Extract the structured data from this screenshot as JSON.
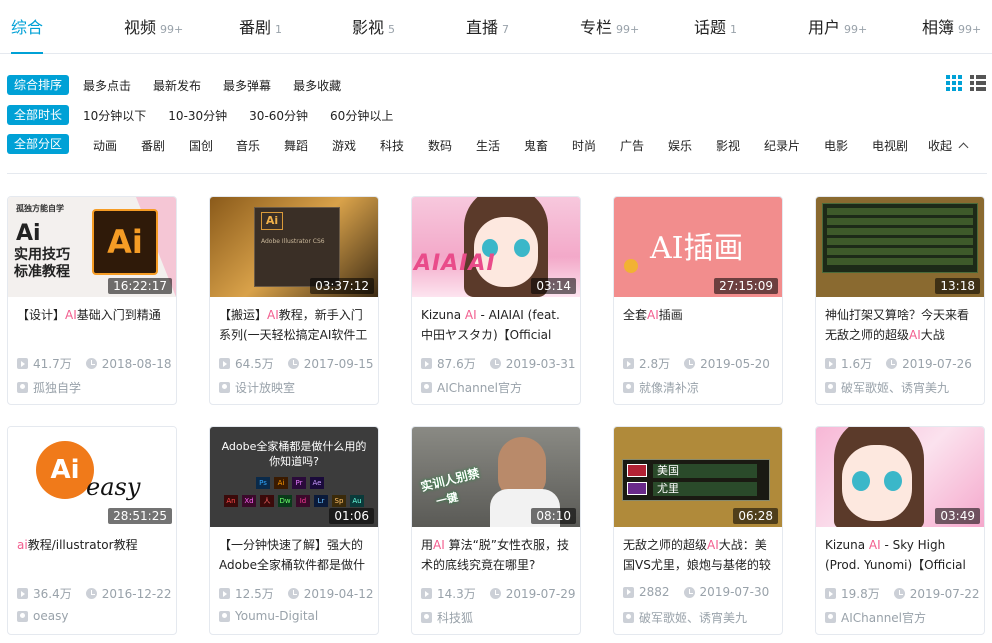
{
  "tabs": [
    {
      "label": "综合",
      "count": ""
    },
    {
      "label": "视频",
      "count": "99+"
    },
    {
      "label": "番剧",
      "count": "1"
    },
    {
      "label": "影视",
      "count": "5"
    },
    {
      "label": "直播",
      "count": "7"
    },
    {
      "label": "专栏",
      "count": "99+"
    },
    {
      "label": "话题",
      "count": "1"
    },
    {
      "label": "用户",
      "count": "99+"
    },
    {
      "label": "相簿",
      "count": "99+"
    }
  ],
  "filters": {
    "order": {
      "tag": "综合排序",
      "options": [
        "最多点击",
        "最新发布",
        "最多弹幕",
        "最多收藏"
      ]
    },
    "duration": {
      "tag": "全部时长",
      "options": [
        "10分钟以下",
        "10-30分钟",
        "30-60分钟",
        "60分钟以上"
      ]
    },
    "zone": {
      "tag": "全部分区",
      "options": [
        "动画",
        "番剧",
        "国创",
        "音乐",
        "舞蹈",
        "游戏",
        "科技",
        "数码",
        "生活",
        "鬼畜",
        "时尚",
        "广告",
        "娱乐",
        "影视",
        "纪录片",
        "电影",
        "电视剧"
      ],
      "collapse": "收起"
    }
  },
  "videos": [
    {
      "duration": "16:22:17",
      "title_pre": "【设计】",
      "title_hl": "AI",
      "title_post": "基础入门到精通",
      "views": "41.7万",
      "date": "2018-08-18",
      "uploader": "孤独自学",
      "thumb": {
        "line1": "孤独方能自学",
        "line2": "Ai",
        "line3": "实用技巧",
        "line4": "标准教程",
        "logo": "Ai"
      }
    },
    {
      "duration": "03:37:12",
      "title_pre": "【搬运】",
      "title_hl": "AI",
      "title_post": "教程，新手入门系列(一天轻松搞定AI软件工",
      "views": "64.5万",
      "date": "2017-09-15",
      "uploader": "设计放映室",
      "thumb": {
        "logo": "Ai",
        "caption": "Adobe Illustrator CS6"
      }
    },
    {
      "duration": "03:14",
      "title_pre": "Kizuna ",
      "title_hl": "AI",
      "title_post": " - AIAIAI (feat. 中田ヤスタカ)【Official Music",
      "views": "87.6万",
      "date": "2019-03-31",
      "uploader": "AIChannel官方",
      "thumb": {
        "text": "AIAIAI"
      }
    },
    {
      "duration": "27:15:09",
      "title_pre": "全套",
      "title_hl": "AI",
      "title_post": "插画",
      "views": "2.8万",
      "date": "2019-05-20",
      "uploader": "就像清补凉",
      "thumb": {
        "text": "AI插画"
      }
    },
    {
      "duration": "13:18",
      "title_pre": "神仙打架又算啥？今天来看无敌之师的超级",
      "title_hl": "AI",
      "title_post": "大战",
      "views": "1.6万",
      "date": "2019-07-26",
      "uploader": "破军歌姬、诱宵美九",
      "thumb": {}
    },
    {
      "duration": "28:51:25",
      "title_pre": "",
      "title_hl": "ai",
      "title_post": "教程/illustrator教程",
      "views": "36.4万",
      "date": "2016-12-22",
      "uploader": "oeasy",
      "thumb": {
        "logo": "Ai",
        "brand": "easy"
      }
    },
    {
      "duration": "01:06",
      "title_pre": "【一分钟快速了解】强大的Adobe全家桶软件都是做什",
      "title_hl": "",
      "title_post": "",
      "views": "12.5万",
      "date": "2019-04-12",
      "uploader": "Youmu-Digital",
      "thumb": {
        "line1": "Adobe全家桶都是做什么用的",
        "line2": "你知道吗?",
        "apps": [
          "Ps",
          "Ai",
          "Pr",
          "Ae",
          "An",
          "Xd",
          "人",
          "Dw",
          "Id",
          "Lr",
          "Sp",
          "Au"
        ]
      }
    },
    {
      "duration": "08:10",
      "title_pre": "用",
      "title_hl": "AI",
      "title_post": " 算法“脱”女性衣服，技术的底线究竟在哪里?",
      "views": "14.3万",
      "date": "2019-07-29",
      "uploader": "科技狐",
      "thumb": {
        "line1": "实训人别禁",
        "line2": "一键"
      }
    },
    {
      "duration": "06:28",
      "title_pre": "无敌之师的超级",
      "title_hl": "AI",
      "title_post": "大战：美国VS尤里，娘炮与基佬的较",
      "views": "2882",
      "date": "2019-07-30",
      "uploader": "破军歌姬、诱宵美九",
      "thumb": {
        "row1": "美国",
        "row2": "尤里"
      }
    },
    {
      "duration": "03:49",
      "title_pre": "Kizuna ",
      "title_hl": "AI",
      "title_post": " - Sky High (Prod. Yunomi)【Official Music",
      "views": "19.8万",
      "date": "2019-07-22",
      "uploader": "AIChannel官方",
      "thumb": {}
    }
  ],
  "colors": {
    "accent": "#00a1d6",
    "highlight": "#f25d8e",
    "muted": "#99a2aa"
  }
}
